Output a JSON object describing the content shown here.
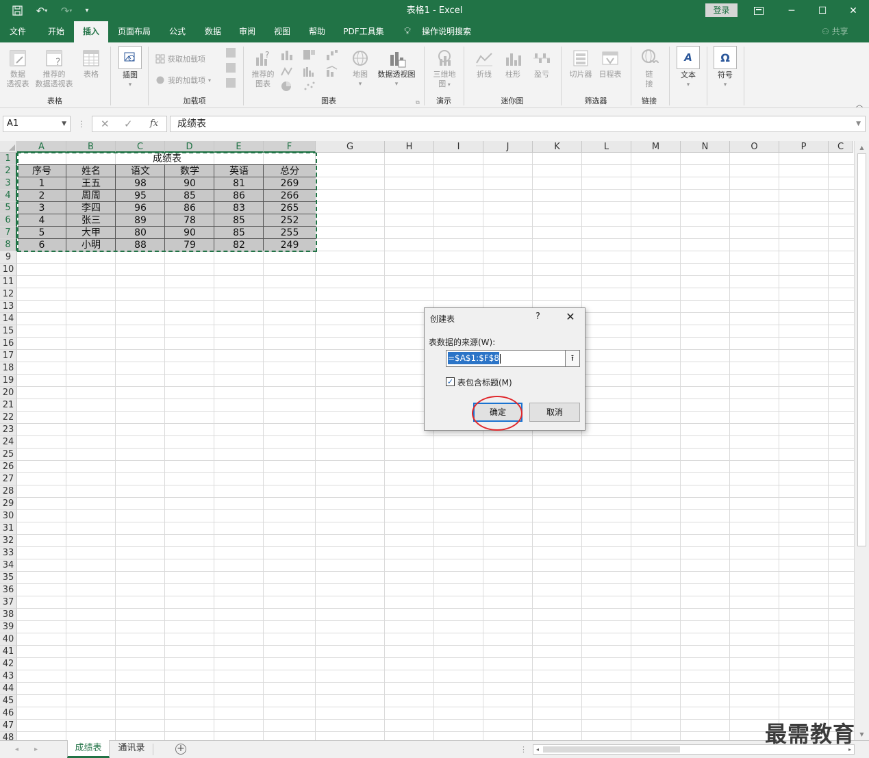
{
  "titlebar": {
    "title": "表格1  -  Excel",
    "login": "登录",
    "save_icon": "save-icon",
    "undo_icon": "undo-icon",
    "redo_icon": "redo-icon"
  },
  "tabs": [
    {
      "label": "文件"
    },
    {
      "label": "开始"
    },
    {
      "label": "插入",
      "active": true
    },
    {
      "label": "页面布局"
    },
    {
      "label": "公式"
    },
    {
      "label": "数据"
    },
    {
      "label": "审阅"
    },
    {
      "label": "视图"
    },
    {
      "label": "帮助"
    },
    {
      "label": "PDF工具集"
    },
    {
      "label": "操作说明搜索"
    }
  ],
  "share": "共享",
  "ribbon": {
    "pivot_line1": "数据",
    "pivot_line2": "透视表",
    "rec_pivot_line1": "推荐的",
    "rec_pivot_line2": "数据透视表",
    "table": "表格",
    "group_table": "表格",
    "illustrations": "插图",
    "get_addins": "获取加载项",
    "my_addins": "我的加载项",
    "group_addins": "加载项",
    "rec_charts_line1": "推荐的",
    "rec_charts_line2": "图表",
    "maps": "地图",
    "pivot_chart": "数据透视图",
    "group_charts": "图表",
    "map3d_line1": "三维地",
    "map3d_line2": "图",
    "group_tours": "演示",
    "spark_line": "折线",
    "spark_column": "柱形",
    "spark_winloss": "盈亏",
    "group_sparklines": "迷你图",
    "slicer": "切片器",
    "timeline": "日程表",
    "group_filters": "筛选器",
    "link_line1": "链",
    "link_line2": "接",
    "group_links": "链接",
    "text": "文本",
    "symbols": "符号"
  },
  "formula_bar": {
    "name_box": "A1",
    "fx": "fx",
    "value": "成绩表"
  },
  "columns": [
    "A",
    "B",
    "C",
    "D",
    "E",
    "F",
    "G",
    "H",
    "I",
    "J",
    "K",
    "L",
    "M",
    "N",
    "O",
    "P",
    "C"
  ],
  "rows": [
    "1",
    "2",
    "3",
    "4",
    "5",
    "6",
    "7",
    "8",
    "9",
    "10",
    "11",
    "12",
    "13",
    "14",
    "15",
    "16",
    "17",
    "18",
    "19",
    "20",
    "21",
    "22",
    "23",
    "24",
    "25",
    "26",
    "27",
    "28",
    "29",
    "30",
    "31",
    "32",
    "33",
    "34",
    "35",
    "36",
    "37",
    "38",
    "39",
    "40",
    "41",
    "42",
    "43",
    "44",
    "45",
    "46",
    "47",
    "48"
  ],
  "table": {
    "title": "成绩表",
    "headers": [
      "序号",
      "姓名",
      "语文",
      "数学",
      "英语",
      "总分"
    ],
    "rows": [
      [
        "1",
        "王五",
        "98",
        "90",
        "81",
        "269"
      ],
      [
        "2",
        "周周",
        "95",
        "85",
        "86",
        "266"
      ],
      [
        "3",
        "李四",
        "96",
        "86",
        "83",
        "265"
      ],
      [
        "4",
        "张三",
        "89",
        "78",
        "85",
        "252"
      ],
      [
        "5",
        "大甲",
        "80",
        "90",
        "85",
        "255"
      ],
      [
        "6",
        "小明",
        "88",
        "79",
        "82",
        "249"
      ]
    ]
  },
  "sheet_tabs": [
    {
      "label": "成绩表",
      "active": true
    },
    {
      "label": "通讯录",
      "active": false
    }
  ],
  "dialog": {
    "title": "创建表",
    "help": "?",
    "close": "✕",
    "source_label": "表数据的来源(W):",
    "source_value": "=$A$1:$F$8",
    "has_headers_label": "表包含标题(M)",
    "has_headers_checked": true,
    "ok": "确定",
    "cancel": "取消"
  },
  "watermark": "最需教育",
  "colors": {
    "brand": "#217346",
    "highlight_circle": "#e0272b",
    "selection_fill": "#c8c8c8"
  }
}
